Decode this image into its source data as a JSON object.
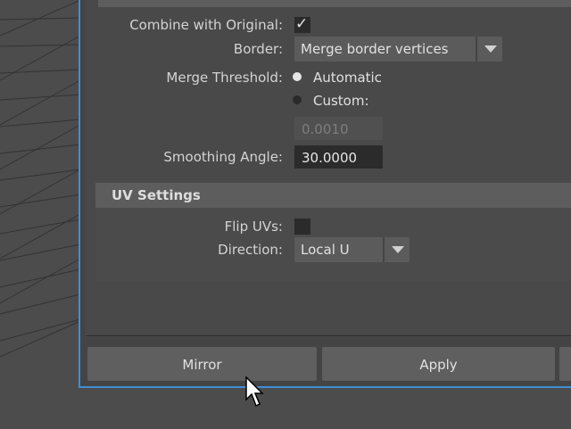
{
  "mirror_options": {
    "combine_with_original_label": "Combine with Original:",
    "combine_with_original_checked": true,
    "border_label": "Border:",
    "border_value": "Merge border vertices",
    "merge_threshold_label": "Merge Threshold:",
    "merge_threshold_options": [
      "Automatic",
      "Custom:"
    ],
    "merge_threshold_selected": "Automatic",
    "custom_value": "0.0010",
    "smoothing_angle_label": "Smoothing Angle:",
    "smoothing_angle_value": "30.0000"
  },
  "uv_settings": {
    "title": "UV Settings",
    "flip_uvs_label": "Flip UVs:",
    "flip_uvs_checked": false,
    "direction_label": "Direction:",
    "direction_value": "Local U"
  },
  "buttons": {
    "mirror": "Mirror",
    "apply": "Apply"
  },
  "colors": {
    "accent_border": "#3d8fd6",
    "panel_bg": "#494949",
    "header_bg": "#5d5d5d"
  }
}
